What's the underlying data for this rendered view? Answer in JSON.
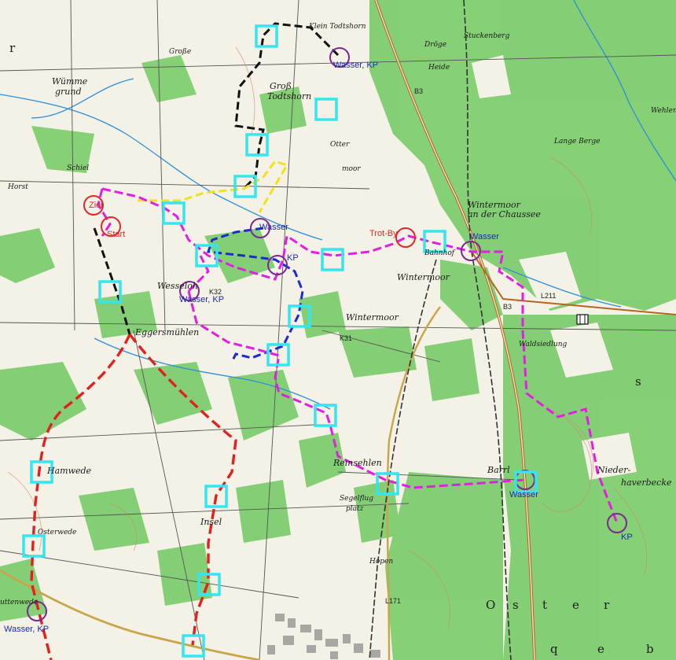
{
  "map": {
    "places": {
      "klein_todtshorn": "Klein Todtshorn",
      "gross": "Groß",
      "todtshorn": "Todtshorn",
      "otter": "Otter",
      "moor": "moor",
      "wintermoor_chaussee_1": "Wintermoor",
      "wintermoor_chaussee_2": "an der Chaussee",
      "bahnhof": "Bahnhof",
      "wintermoor_1": "Wintermoor",
      "wintermoor_2": "Wintermoor",
      "wesseloh": "Wesseloh",
      "eggersmuehlen": "Eggersmühlen",
      "reinsehlen": "Reinsehlen",
      "barrl": "Barrl",
      "nieder": "Nieder-",
      "haverbecke": "haverbecke",
      "hamwede": "Hamwede",
      "osterwede": "Osterwede",
      "insel": "Insel",
      "hopen": "Hopen",
      "segelflugplatz_1": "Segelflug",
      "segelflugplatz_2": "platz",
      "lange_berge": "Lange Berge",
      "waldsiedlung": "Waldsiedlung",
      "stuckenberg": "Stuckenberg",
      "droege": "Dröge",
      "heide": "Heide",
      "wehlen": "Wehlen",
      "horst": "Horst",
      "schiel": "Schiel",
      "wuemme_grund_1": "Wümme",
      "wuemme_grund_2": "grund",
      "grosse": "Große",
      "suttenwede": "uttenwede"
    },
    "markers": {
      "wasser_kp_top": "Wasser, KP",
      "wasser_center": "Wasser",
      "kp_center": "KP",
      "wasser_kp_wesseloh": "Wasser, KP",
      "wasser_bahnhof": "Wasser",
      "trot_by": "Trot-By",
      "ziel": "Ziel",
      "start": "Start",
      "wasser_barrl": "Wasser",
      "kp_southeast": "KP",
      "wasser_kp_southwest": "Wasser, KP"
    },
    "roads": {
      "b3_north": "B3",
      "b3_south": "B3",
      "k32": "K32",
      "k31": "K31",
      "l171": "L171",
      "l211": "L211"
    },
    "lettering": [
      "O",
      "s",
      "t",
      "e",
      "r",
      "q",
      "e",
      "b",
      "s",
      "r"
    ],
    "colors": {
      "forest": "#7fce6f",
      "paper": "#f4f1e6",
      "checkpoint": "#35e6ee",
      "magenta_route": "#e21ee0",
      "red_route": "#e0221f",
      "black_route": "#111111",
      "yellow_route": "#f2e21a",
      "blue_route": "#1a2bd6",
      "kp_circle": "#7a2a8e",
      "trot_circle": "#e0282c",
      "road": "#b5651d",
      "rail": "#333333"
    }
  }
}
